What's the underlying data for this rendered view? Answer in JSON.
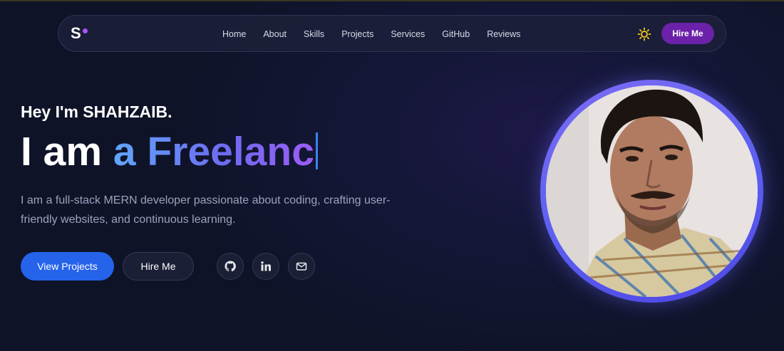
{
  "navbar": {
    "logo_text": "S",
    "links": [
      "Home",
      "About",
      "Skills",
      "Projects",
      "Services",
      "GitHub",
      "Reviews"
    ],
    "theme_icon": "sun-icon",
    "hire_label": "Hire Me"
  },
  "hero": {
    "greeting": "Hey I'm SHAHZAIB.",
    "headline_static": "I am ",
    "headline_typed": "a Freelanc",
    "description": "I am a full-stack MERN developer passionate about coding, crafting user-friendly websites, and continuous learning.",
    "primary_button": "View Projects",
    "secondary_button": "Hire Me",
    "social_icons": [
      "github-icon",
      "linkedin-icon",
      "mail-icon"
    ]
  },
  "colors": {
    "accent_purple": "#6b21a8",
    "primary_blue": "#2563eb",
    "gradient_start": "#60a5fa",
    "gradient_end": "#9b5cf6",
    "logo_dot": "#a855f7"
  }
}
